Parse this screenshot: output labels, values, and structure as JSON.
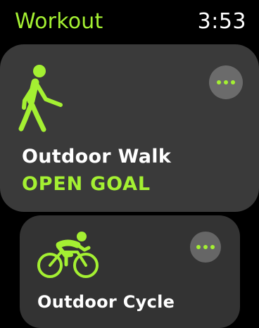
{
  "status": {
    "app_title": "Workout",
    "time": "3:53"
  },
  "colors": {
    "accent": "#a4f032",
    "card_background": "#3a3a3a",
    "more_button_background": "#6b6b6b",
    "text_primary": "#ffffff"
  },
  "workouts": [
    {
      "name": "Outdoor Walk",
      "goal": "OPEN GOAL",
      "icon": "walking-figure-icon"
    },
    {
      "name": "Outdoor Cycle",
      "icon": "cycling-figure-icon"
    }
  ]
}
